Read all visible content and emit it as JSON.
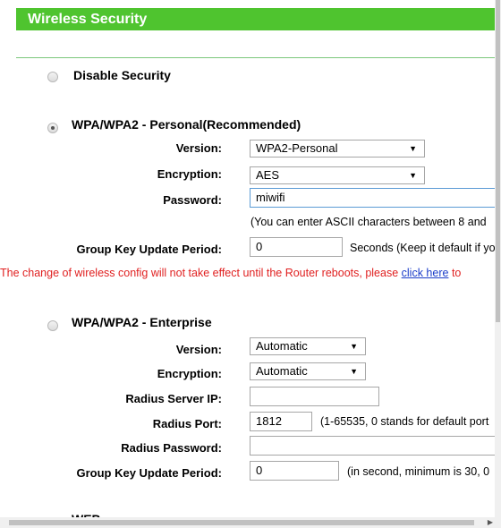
{
  "header": {
    "title": "Wireless Security"
  },
  "disable": {
    "label": "Disable Security"
  },
  "personal": {
    "label": "WPA/WPA2 - Personal(Recommended)",
    "version_label": "Version:",
    "version_value": "WPA2-Personal",
    "encryption_label": "Encryption:",
    "encryption_value": "AES",
    "password_label": "Password:",
    "password_value": "miwifi",
    "password_hint": "(You can enter ASCII characters between 8 and",
    "gkup_label": "Group Key Update Period:",
    "gkup_value": "0",
    "gkup_hint": "Seconds (Keep it default if yo"
  },
  "warning": {
    "text": "The change of wireless config will not take effect until the Router reboots, please",
    "link": "click here",
    "after": "to"
  },
  "enterprise": {
    "label": "WPA/WPA2 - Enterprise",
    "version_label": "Version:",
    "version_value": "Automatic",
    "encryption_label": "Encryption:",
    "encryption_value": "Automatic",
    "radius_ip_label": "Radius Server IP:",
    "radius_ip_value": "",
    "radius_port_label": "Radius Port:",
    "radius_port_value": "1812",
    "radius_port_hint": "(1-65535, 0 stands for default port",
    "radius_pw_label": "Radius Password:",
    "radius_pw_value": "",
    "gkup_label": "Group Key Update Period:",
    "gkup_value": "0",
    "gkup_hint": "(in second, minimum is 30, 0"
  },
  "wep": {
    "label": "WEP"
  }
}
